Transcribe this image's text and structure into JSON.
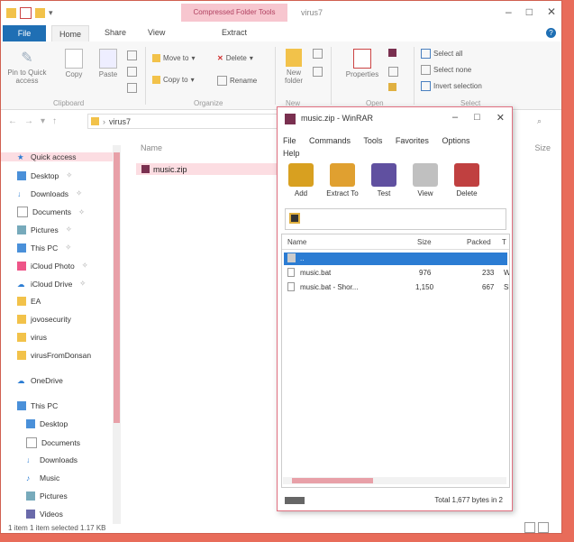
{
  "explorer": {
    "contextual_tab": "Compressed Folder Tools",
    "window_title": "virus7",
    "tabs": {
      "file": "File",
      "home": "Home",
      "share": "Share",
      "view": "View",
      "extract": "Extract"
    },
    "ribbon": {
      "pin_label": "Pin to Quick access",
      "copy_label": "Copy",
      "paste_label": "Paste",
      "clipboard_label": "Clipboard",
      "move_to": "Move to",
      "copy_to": "Copy to",
      "delete": "Delete",
      "rename": "Rename",
      "organize_label": "Organize",
      "new_folder": "New folder",
      "new_label": "New",
      "properties": "Properties",
      "open_label": "Open",
      "select_all": "Select all",
      "select_none": "Select none",
      "invert_selection": "Invert selection",
      "select_label": "Select"
    },
    "address": {
      "folder": "virus7"
    },
    "columns": {
      "name": "Name",
      "size": "Size"
    },
    "file": {
      "name": "music.zip"
    },
    "nav": [
      {
        "label": "Quick access"
      },
      {
        "label": "Desktop"
      },
      {
        "label": "Downloads"
      },
      {
        "label": "Documents"
      },
      {
        "label": "Pictures"
      },
      {
        "label": "This PC"
      },
      {
        "label": "iCloud Photo"
      },
      {
        "label": "iCloud Drive"
      },
      {
        "label": "EA"
      },
      {
        "label": "jovosecurity"
      },
      {
        "label": "virus"
      },
      {
        "label": "virusFromDonsan"
      },
      {
        "label": "OneDrive"
      },
      {
        "label": "This PC"
      },
      {
        "label": "Desktop"
      },
      {
        "label": "Documents"
      },
      {
        "label": "Downloads"
      },
      {
        "label": "Music"
      },
      {
        "label": "Pictures"
      },
      {
        "label": "Videos"
      }
    ],
    "status": "1 item    1 item selected  1.17 KB"
  },
  "winrar": {
    "title": "music.zip - WinRAR",
    "menu": [
      "File",
      "Commands",
      "Tools",
      "Favorites",
      "Options",
      "Help"
    ],
    "tools": [
      {
        "label": "Add",
        "color": "#d8a020"
      },
      {
        "label": "Extract To",
        "color": "#e0a030"
      },
      {
        "label": "Test",
        "color": "#6050a0"
      },
      {
        "label": "View",
        "color": "#c0c0c0"
      },
      {
        "label": "Delete",
        "color": "#c04040"
      }
    ],
    "columns": {
      "name": "Name",
      "size": "Size",
      "packed": "Packed",
      "type": "T"
    },
    "rows": [
      {
        "name": "..",
        "size": "",
        "packed": "",
        "type": ""
      },
      {
        "name": "music.bat",
        "size": "976",
        "packed": "233",
        "type": "W"
      },
      {
        "name": "music.bat - Shor...",
        "size": "1,150",
        "packed": "667",
        "type": "Sh"
      }
    ],
    "status": "Total 1,677 bytes in 2"
  }
}
